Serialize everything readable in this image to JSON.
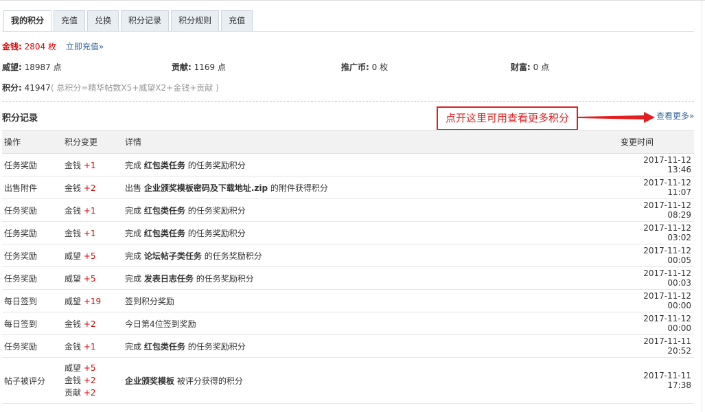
{
  "tabs": [
    "我的积分",
    "充值",
    "兑换",
    "积分记录",
    "积分规则",
    "充值"
  ],
  "money": {
    "label": "金钱:",
    "value": "2804 枚",
    "link": "立即充值»"
  },
  "stats": [
    {
      "label": "威望:",
      "value": "18987 点"
    },
    {
      "label": "贡献:",
      "value": "1169 点"
    },
    {
      "label": "推广币:",
      "value": "0 枚"
    },
    {
      "label": "财富:",
      "value": "0 点"
    }
  ],
  "total": {
    "label": "积分:",
    "value": "41947",
    "formula": "( 总积分=精华帖数X5+威望X2+金钱+贡献 )"
  },
  "section": {
    "title": "积分记录",
    "more": "查看更多»"
  },
  "callout": {
    "text": "点开这里可用查看更多积分",
    "color": "#e02020"
  },
  "table": {
    "headers": [
      "操作",
      "积分变更",
      "详情",
      "变更时间"
    ],
    "rows": [
      {
        "op": "任务奖励",
        "changes": [
          {
            "type": "金钱",
            "delta": "+1"
          }
        ],
        "pre": "完成",
        "bold": "红包类任务",
        "post": "的任务奖励积分",
        "time": "2017-11-12 13:46"
      },
      {
        "op": "出售附件",
        "changes": [
          {
            "type": "金钱",
            "delta": "+2"
          }
        ],
        "pre": "出售",
        "bold": "企业颁奖模板密码及下载地址.zip",
        "post": "的附件获得积分",
        "time": "2017-11-12 11:07"
      },
      {
        "op": "任务奖励",
        "changes": [
          {
            "type": "金钱",
            "delta": "+1"
          }
        ],
        "pre": "完成",
        "bold": "红包类任务",
        "post": "的任务奖励积分",
        "time": "2017-11-12 08:29"
      },
      {
        "op": "任务奖励",
        "changes": [
          {
            "type": "金钱",
            "delta": "+1"
          }
        ],
        "pre": "完成",
        "bold": "红包类任务",
        "post": "的任务奖励积分",
        "time": "2017-11-12 03:02"
      },
      {
        "op": "任务奖励",
        "changes": [
          {
            "type": "威望",
            "delta": "+5"
          }
        ],
        "pre": "完成",
        "bold": "论坛帖子类任务",
        "post": "的任务奖励积分",
        "time": "2017-11-12 00:05"
      },
      {
        "op": "任务奖励",
        "changes": [
          {
            "type": "威望",
            "delta": "+5"
          }
        ],
        "pre": "完成",
        "bold": "发表日志任务",
        "post": "的任务奖励积分",
        "time": "2017-11-12 00:03"
      },
      {
        "op": "每日签到",
        "changes": [
          {
            "type": "威望",
            "delta": "+19"
          }
        ],
        "pre": "签到积分奖励",
        "bold": "",
        "post": "",
        "time": "2017-11-12 00:00"
      },
      {
        "op": "每日签到",
        "changes": [
          {
            "type": "金钱",
            "delta": "+2"
          }
        ],
        "pre": "今日第4位签到奖励",
        "bold": "",
        "post": "",
        "time": "2017-11-12 00:00"
      },
      {
        "op": "任务奖励",
        "changes": [
          {
            "type": "金钱",
            "delta": "+1"
          }
        ],
        "pre": "完成",
        "bold": "红包类任务",
        "post": "的任务奖励积分",
        "time": "2017-11-11 20:52"
      },
      {
        "op": "帖子被评分",
        "changes": [
          {
            "type": "威望",
            "delta": "+5"
          },
          {
            "type": "金钱",
            "delta": "+2"
          },
          {
            "type": "贡献",
            "delta": "+2"
          }
        ],
        "pre": "",
        "bold": "企业颁奖模板",
        "post": "被评分获得的积分",
        "time": "2017-11-11 17:38"
      }
    ]
  },
  "colors": {
    "accent": "#d00000",
    "link": "#336699",
    "tab_bg": "#e9eef3"
  }
}
